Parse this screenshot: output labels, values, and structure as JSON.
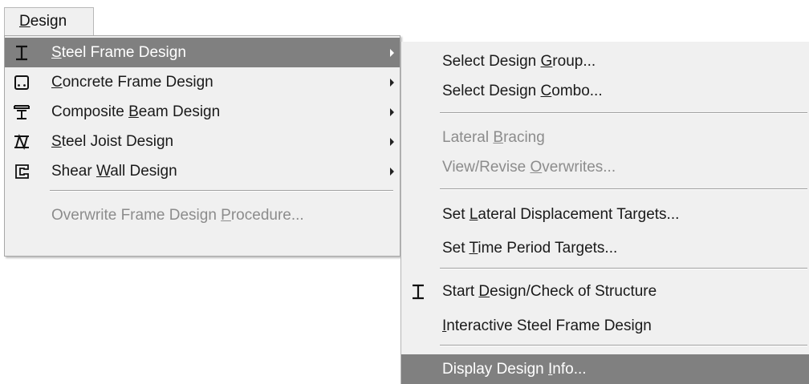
{
  "menubar": {
    "design": {
      "label_underlined": "D",
      "label_rest": "esign"
    }
  },
  "main_menu": {
    "items": [
      {
        "pre": "",
        "mn": "S",
        "post": "teel Frame Design",
        "icon": "i-beam-icon",
        "submenu": true,
        "state": "highlighted"
      },
      {
        "pre": "",
        "mn": "C",
        "post": "oncrete Frame Design",
        "icon": "concrete-section-icon",
        "submenu": true,
        "state": "normal"
      },
      {
        "pre": "Composite ",
        "mn": "B",
        "post": "eam Design",
        "icon": "composite-beam-icon",
        "submenu": true,
        "state": "normal"
      },
      {
        "pre": "",
        "mn": "S",
        "post": "teel Joist Design",
        "icon": "steel-joist-icon",
        "submenu": true,
        "state": "normal"
      },
      {
        "pre": "Shear ",
        "mn": "W",
        "post": "all Design",
        "icon": "shear-wall-icon",
        "submenu": true,
        "state": "normal"
      },
      {
        "pre": "Overwrite Frame Design ",
        "mn": "P",
        "post": "rocedure...",
        "icon": "",
        "submenu": false,
        "state": "disabled"
      }
    ]
  },
  "sub_menu": {
    "items": [
      {
        "pre": "Select Design ",
        "mn": "G",
        "post": "roup...",
        "state": "normal",
        "icon": ""
      },
      {
        "pre": "Select Design ",
        "mn": "C",
        "post": "ombo...",
        "state": "normal",
        "icon": ""
      },
      {
        "pre": "Lateral ",
        "mn": "B",
        "post": "racing",
        "state": "disabled",
        "icon": ""
      },
      {
        "pre": "View/Revise ",
        "mn": "O",
        "post": "verwrites...",
        "state": "disabled",
        "icon": ""
      },
      {
        "pre": "Set ",
        "mn": "L",
        "post": "ateral Displacement Targets...",
        "state": "normal",
        "icon": ""
      },
      {
        "pre": "Set ",
        "mn": "T",
        "post": "ime Period Targets...",
        "state": "normal",
        "icon": ""
      },
      {
        "pre": "Start ",
        "mn": "D",
        "post": "esign/Check of Structure",
        "state": "normal",
        "icon": "i-beam-icon"
      },
      {
        "pre": "",
        "mn": "I",
        "post": "nteractive Steel Frame Design",
        "state": "normal",
        "icon": ""
      },
      {
        "pre": "Display Design ",
        "mn": "I",
        "post": "nfo...",
        "state": "highlighted",
        "icon": ""
      }
    ]
  },
  "colors": {
    "menu_bg": "#f0f0f0",
    "highlight_bg": "#808080",
    "disabled_text": "#8c8c8c"
  }
}
